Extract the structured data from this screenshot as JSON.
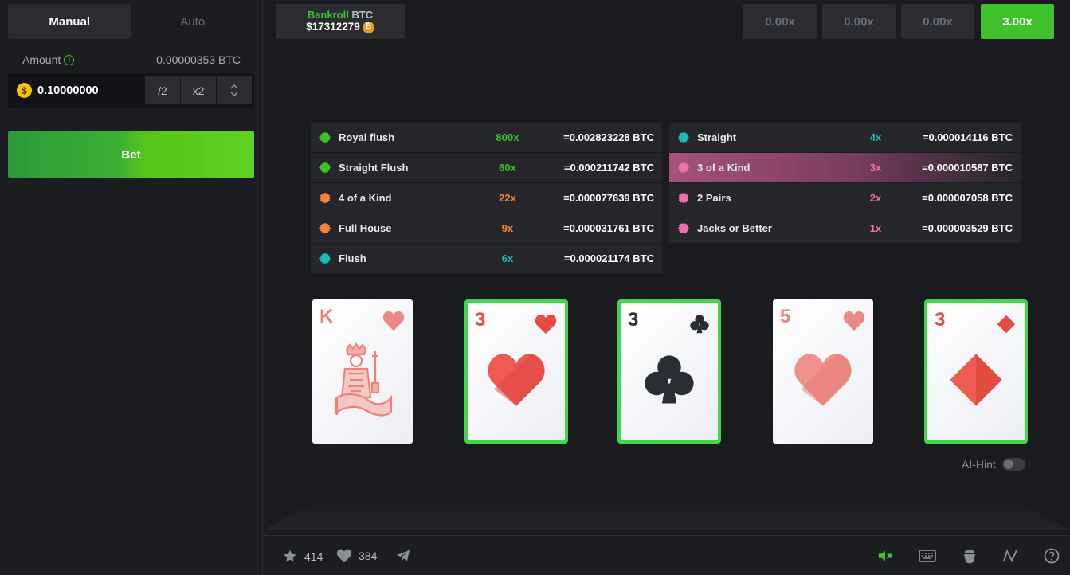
{
  "sidebar": {
    "tabs": [
      {
        "label": "Manual",
        "active": true
      },
      {
        "label": "Auto",
        "active": false
      }
    ],
    "amount_label": "Amount",
    "amount_btc": "0.00000353 BTC",
    "amount_value": "0.10000000",
    "half_label": "/2",
    "double_label": "x2",
    "bet_label": "Bet"
  },
  "bankroll": {
    "title_green": "Bankroll",
    "title_gray": "BTC",
    "value": "$17312279"
  },
  "multipliers": [
    "0.00x",
    "0.00x",
    "0.00x",
    "3.00x"
  ],
  "paytable": {
    "left": [
      {
        "name": "Royal flush",
        "mult": "800x",
        "btc": "=0.002823228 BTC",
        "color": "#3ec12a",
        "dot": "green"
      },
      {
        "name": "Straight Flush",
        "mult": "60x",
        "btc": "=0.000211742 BTC",
        "color": "#3ec12a",
        "dot": "green"
      },
      {
        "name": "4 of a Kind",
        "mult": "22x",
        "btc": "=0.000077639 BTC",
        "color": "#f5843a",
        "dot": "orange"
      },
      {
        "name": "Full House",
        "mult": "9x",
        "btc": "=0.000031761 BTC",
        "color": "#f5843a",
        "dot": "orange"
      },
      {
        "name": "Flush",
        "mult": "6x",
        "btc": "=0.000021174 BTC",
        "color": "#1fb8b8",
        "dot": "teal"
      }
    ],
    "right": [
      {
        "name": "Straight",
        "mult": "4x",
        "btc": "=0.000014116 BTC",
        "color": "#1fb8b8",
        "dot": "teal"
      },
      {
        "name": "3 of a Kind",
        "mult": "3x",
        "btc": "=0.000010587 BTC",
        "color": "#f06fae",
        "dot": "pink",
        "highlight": true
      },
      {
        "name": "2 Pairs",
        "mult": "2x",
        "btc": "=0.000007058 BTC",
        "color": "#f06fae",
        "dot": "pink"
      },
      {
        "name": "Jacks or Better",
        "mult": "1x",
        "btc": "=0.000003529 BTC",
        "color": "#f06fae",
        "dot": "pink"
      }
    ]
  },
  "cards": [
    {
      "rank": "K",
      "suit": "heart",
      "held": false
    },
    {
      "rank": "3",
      "suit": "heart",
      "held": true
    },
    {
      "rank": "3",
      "suit": "club",
      "held": true
    },
    {
      "rank": "5",
      "suit": "heart",
      "held": false
    },
    {
      "rank": "3",
      "suit": "diamond",
      "held": true
    }
  ],
  "ai_hint_label": "AI-Hint",
  "footer": {
    "stars": "414",
    "likes": "384",
    "icons": [
      "star-icon",
      "heart-icon",
      "telegram-icon",
      "sound-icon",
      "keyboard-icon",
      "fairness-icon",
      "stats-icon",
      "help-icon"
    ]
  }
}
